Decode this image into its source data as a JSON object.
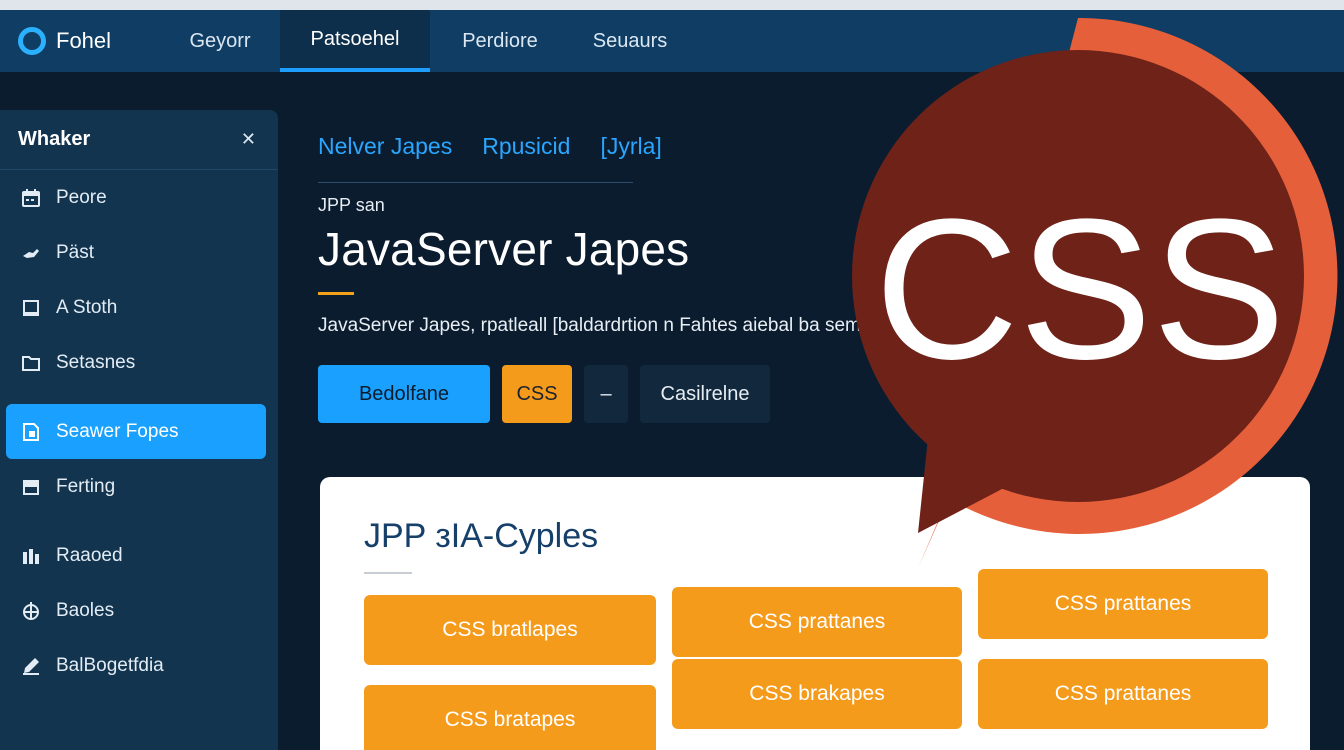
{
  "nav": {
    "logo_text": "Fohel",
    "tabs": [
      {
        "label": "Geyorr"
      },
      {
        "label": "Patsoehel"
      },
      {
        "label": "Perdiore"
      },
      {
        "label": "Seuaurs"
      }
    ]
  },
  "sidebar": {
    "title": "Whaker",
    "collapse_glyph": "✕",
    "items": [
      {
        "label": "Peore",
        "icon": "calendar-icon"
      },
      {
        "label": "Päst",
        "icon": "hand-icon"
      },
      {
        "label": "A Stoth",
        "icon": "square-icon"
      },
      {
        "label": "Setasnes",
        "icon": "folder-icon"
      },
      {
        "label": "Seawer Fopes",
        "icon": "page-icon"
      },
      {
        "label": "Ferting",
        "icon": "tray-icon"
      },
      {
        "label": "Raaoed",
        "icon": "grid-icon"
      },
      {
        "label": "Baoles",
        "icon": "globe-icon"
      },
      {
        "label": "BalBogetfdia",
        "icon": "edit-icon"
      }
    ]
  },
  "main": {
    "breadcrumbs": [
      "Nelver Japes",
      "Rpusicid",
      "[Jyrla]"
    ],
    "eyebrow": "JPP san",
    "title": "JavaServer Japes",
    "description": "JavaServer Japes, rpatleall [baldardrtion n Fahtes aiebal ba semeabedis Bion",
    "buttons": {
      "primary": "Bedolfane",
      "css": "CSS",
      "minus": "–",
      "ghost": "Casilrelne"
    }
  },
  "card": {
    "title": "JPP зIA-Cyples",
    "chips": [
      "CSS bratlapes",
      "CSS prattanes",
      "CSS prattanes",
      "CSS bratapes",
      "CSS brakapes",
      "CSS prattanes"
    ]
  },
  "overlay": {
    "badge_text": "CSS",
    "ring_color": "#e5603a",
    "fill_color": "#6e2218"
  },
  "colors": {
    "accent_blue": "#1aa1ff",
    "accent_orange": "#f59b1c",
    "nav_bg": "#0f3d63",
    "page_bg": "#0b1c2e"
  }
}
